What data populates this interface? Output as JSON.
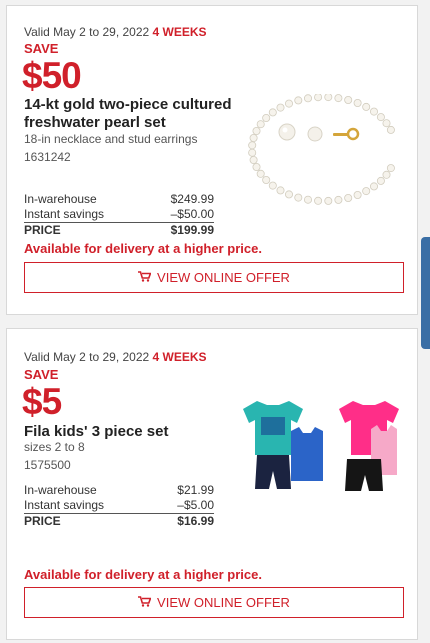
{
  "offers": [
    {
      "valid": "Valid May 2 to 29, 2022",
      "weeks": "4 WEEKS",
      "save_label": "SAVE",
      "save_amount": "$50",
      "title": "14-kt gold two-piece cultured freshwater pearl set",
      "description": "18-in necklace and stud earrings",
      "item_number": "1631242",
      "prices": [
        {
          "label": "In-warehouse",
          "value": "$249.99"
        },
        {
          "label": "Instant savings",
          "value": "–$50.00"
        },
        {
          "label": "PRICE",
          "value": "$199.99"
        }
      ],
      "delivery_note": "Available for delivery at a higher price.",
      "button_label": "VIEW ONLINE OFFER"
    },
    {
      "valid": "Valid May 2 to 29, 2022",
      "weeks": "4 WEEKS",
      "save_label": "SAVE",
      "save_amount": "$5",
      "title": "Fila kids' 3 piece set",
      "description": "sizes 2 to 8",
      "item_number": "1575500",
      "prices": [
        {
          "label": "In-warehouse",
          "value": "$21.99"
        },
        {
          "label": "Instant savings",
          "value": "–$5.00"
        },
        {
          "label": "PRICE",
          "value": "$16.99"
        }
      ],
      "delivery_note": "Available for delivery at a higher price.",
      "button_label": "VIEW ONLINE OFFER"
    }
  ],
  "icons": {
    "cart": "shopping-cart-icon"
  },
  "colors": {
    "accent_red": "#d0202a",
    "side_tab": "#3a6ea5"
  }
}
